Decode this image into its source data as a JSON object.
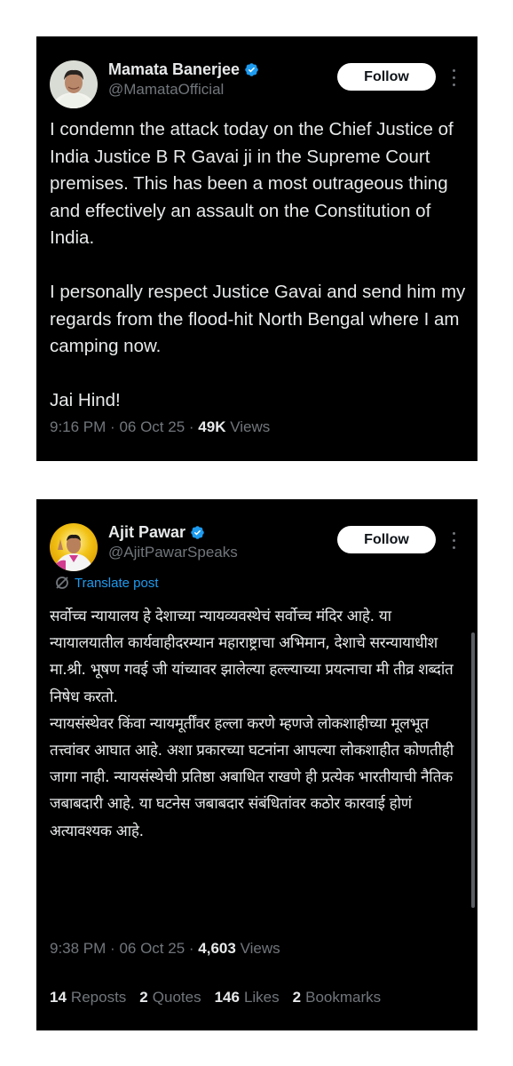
{
  "colors": {
    "card_bg": "#000000",
    "text": "#e7e9ea",
    "secondary": "#71767b",
    "verified": "#1d9bf0",
    "link": "#1d9bf0",
    "follow_bg": "#ffffff"
  },
  "posts": [
    {
      "author": {
        "name": "Mamata Banerjee",
        "handle": "@MamataOfficial",
        "verified_icon": "verified-badge-icon"
      },
      "follow_label": "Follow",
      "text": "I condemn the attack today on the Chief Justice of India Justice B R Gavai ji in the Supreme Court premises. This has been a most outrageous thing and effectively an assault on the Constitution of India.\n\nI personally respect Justice Gavai and send him my regards from the flood-hit North Bengal where I am camping now.\n\nJai Hind!",
      "time": "9:16 PM",
      "date": "06 Oct 25",
      "views_count": "49K",
      "views_label": "Views"
    },
    {
      "author": {
        "name": "Ajit Pawar",
        "handle": "@AjitPawarSpeaks",
        "verified_icon": "verified-badge-icon"
      },
      "follow_label": "Follow",
      "translate_label": "Translate post",
      "text": "सर्वोच्च न्यायालय हे देशाच्या न्यायव्यवस्थेचं सर्वोच्च मंदिर आहे. या न्यायालयातील कार्यवाहीदरम्यान महाराष्ट्राचा अभिमान, देशाचे सरन्यायाधीश मा.श्री. भूषण गवई जी यांच्यावर झालेल्या हल्ल्याच्या प्रयत्नाचा मी तीव्र शब्दांत निषेध करतो.\nन्यायसंस्थेवर किंवा न्यायमूर्तींवर हल्ला करणे म्हणजे लोकशाहीच्या मूलभूत तत्त्वांवर आघात आहे. अशा प्रकारच्या घटनांना आपल्या लोकशाहीत कोणतीही जागा नाही. न्यायसंस्थेची प्रतिष्ठा अबाधित राखणे ही प्रत्येक भारतीयाची नैतिक जबाबदारी आहे. या घटनेस जबाबदार संबंधितांवर कठोर कारवाई होणं अत्यावश्यक आहे.",
      "time": "9:38 PM",
      "date": "06 Oct 25",
      "views_count": "4,603",
      "views_label": "Views",
      "stats": [
        {
          "count": "14",
          "label": "Reposts"
        },
        {
          "count": "2",
          "label": "Quotes"
        },
        {
          "count": "146",
          "label": "Likes"
        },
        {
          "count": "2",
          "label": "Bookmarks"
        }
      ]
    }
  ]
}
